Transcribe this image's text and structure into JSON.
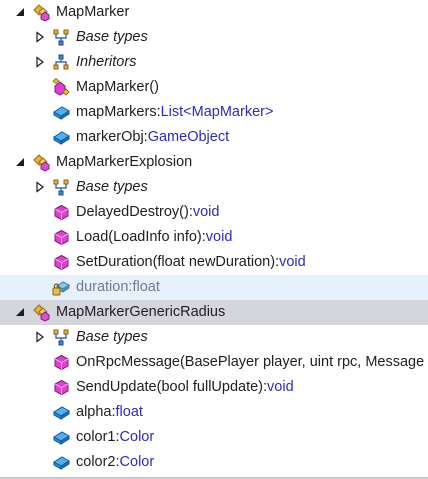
{
  "tree": {
    "rows": [
      {
        "level": 0,
        "expander": "expanded",
        "icon": "class-icon",
        "label": "MapMarker"
      },
      {
        "level": 1,
        "expander": "collapsed",
        "icon": "base-types-icon",
        "label": "Base types",
        "italic": true
      },
      {
        "level": 1,
        "expander": "collapsed",
        "icon": "inheritors-icon",
        "label": "Inheritors",
        "italic": true
      },
      {
        "level": 1,
        "expander": "none",
        "icon": "constructor-icon",
        "label": "MapMarker()"
      },
      {
        "level": 1,
        "expander": "none",
        "icon": "field-icon",
        "label": "mapMarkers:",
        "type": "List<MapMarker>"
      },
      {
        "level": 1,
        "expander": "none",
        "icon": "field-icon",
        "label": "markerObj:",
        "type": "GameObject"
      },
      {
        "level": 0,
        "expander": "expanded",
        "icon": "class-icon",
        "label": "MapMarkerExplosion"
      },
      {
        "level": 1,
        "expander": "collapsed",
        "icon": "base-types-icon",
        "label": "Base types",
        "italic": true
      },
      {
        "level": 1,
        "expander": "none",
        "icon": "method-icon",
        "label": "DelayedDestroy():",
        "type": "void"
      },
      {
        "level": 1,
        "expander": "none",
        "icon": "method-icon",
        "label": "Load(LoadInfo info):",
        "type": "void"
      },
      {
        "level": 1,
        "expander": "none",
        "icon": "method-icon",
        "label": "SetDuration(float newDuration):",
        "type": "void"
      },
      {
        "level": 1,
        "expander": "none",
        "icon": "private-field-icon",
        "label": "duration:",
        "type": "float",
        "muted": true,
        "state": "hover"
      },
      {
        "level": 0,
        "expander": "expanded",
        "icon": "class-icon",
        "label": "MapMarkerGenericRadius",
        "state": "selected"
      },
      {
        "level": 1,
        "expander": "collapsed",
        "icon": "base-types-icon",
        "label": "Base types",
        "italic": true
      },
      {
        "level": 1,
        "expander": "none",
        "icon": "method-icon",
        "label": "OnRpcMessage(BasePlayer player, uint rpc, Message m"
      },
      {
        "level": 1,
        "expander": "none",
        "icon": "method-icon",
        "label": "SendUpdate(bool fullUpdate):",
        "type": "void"
      },
      {
        "level": 1,
        "expander": "none",
        "icon": "field-icon",
        "label": "alpha:",
        "type": "float"
      },
      {
        "level": 1,
        "expander": "none",
        "icon": "field-icon",
        "label": "color1:",
        "type": "Color"
      },
      {
        "level": 1,
        "expander": "none",
        "icon": "field-icon",
        "label": "color2:",
        "type": "Color"
      }
    ]
  },
  "colors": {
    "type_text": "#2b2bc2",
    "hover_row": "#e5f1fb",
    "selected_row": "#d5d5de",
    "method_icon": "#e040d0",
    "field_icon": "#1f8ce0",
    "class_icon": "#f0b030"
  }
}
